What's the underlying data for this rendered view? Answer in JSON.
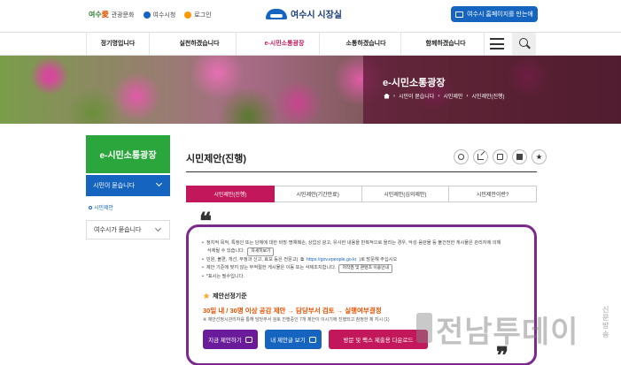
{
  "header": {
    "links": [
      "관광문화",
      "여수시청",
      "로그인"
    ],
    "logo_text": "여수시 시장실",
    "site_button": "여수시 홈페이지를 만는애"
  },
  "nav": {
    "items": [
      "정기명입니다",
      "실천하겠습니다",
      "e-시민소통광장",
      "소통하겠습니다",
      "함께하겠습니다"
    ]
  },
  "banner": {
    "title": "e-시민소통광장",
    "breadcrumb": [
      "시민이 묻습니다",
      "시민제안",
      "시민제안(진행)"
    ]
  },
  "sidebar": {
    "title": "e-시민소통광장",
    "active": "시민이 묻습니다",
    "sub": "시민제안",
    "item": "여수시가 묻습니다"
  },
  "page": {
    "title": "시민제안(진행)"
  },
  "tabs": [
    "시민제안(진행)",
    "시민제안(기간만료)",
    "시민제안(심의제안)",
    "시민제안이란?"
  ],
  "notice": {
    "lines": [
      "정치적 목적, 특정인 또는 단체에 대한 비방·명예훼손, 상업성 광고, 유사한 내용을 반복적으로 올리는 경우, 악성·음란물 등 불건전한 게시물은 관리자에 의해",
      "삭제될 수 있습니다.",
      "민원, 불편, 개선, 부정과 신고, 효보 등은 전문고(",
      "https://gov.epeople.go.kr",
      ")로 방문해 주십시오",
      "제안 기준에 맞지 않는 부적절한 게시물은 이동 또는 삭제조치합니다.",
      "*표시는 필수입니다."
    ],
    "mini_buttons": [
      "자세히보기",
      "저작권 및 콘텐츠 이용안내"
    ],
    "criteria_title": "제안선정기준",
    "criteria_main": "30일 내 / 30명 이상 공감 제안 → 담당부서 검토 → 실행여부결정",
    "criteria_note": "※ 제안선정시관리자를 통해 담당부서 검토 진행중인 7개 제안이 이시기에 진행되고 참정한 제 지시 (1)",
    "buttons": [
      "지금 제안하기",
      "내 제안글 보기",
      "방문 및 팩스 제출용 다운로드"
    ]
  },
  "watermark": {
    "text": "전남투데이",
    "sub": "신문방송"
  }
}
